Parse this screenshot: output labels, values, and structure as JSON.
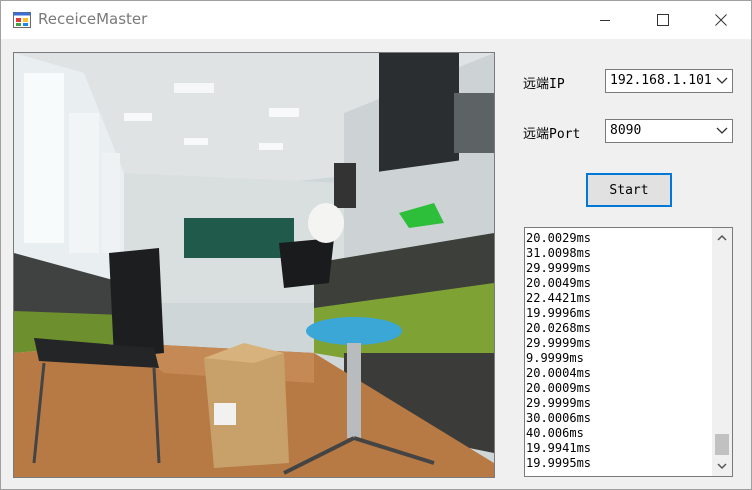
{
  "window": {
    "title": "ReceiceMaster",
    "icon": "app-window-icon",
    "controls": {
      "minimize": "minimize-icon",
      "maximize": "maximize-icon",
      "close": "close-icon"
    }
  },
  "camera_view": {
    "description_icon": "camera-frame-image"
  },
  "form": {
    "remote_ip_label": "远端IP",
    "remote_ip_value": "192.168.1.101",
    "remote_port_label": "远端Port",
    "remote_port_value": "8090",
    "start_label": "Start"
  },
  "log": {
    "items": [
      "20.0029ms",
      "31.0098ms",
      "29.9999ms",
      "20.0049ms",
      "22.4421ms",
      "19.9996ms",
      "20.0268ms",
      "29.9999ms",
      "9.9999ms",
      "20.0004ms",
      "20.0009ms",
      "29.9999ms",
      "30.0006ms",
      "40.006ms",
      "19.9941ms",
      "19.9995ms"
    ]
  },
  "colors": {
    "accent": "#0078d7",
    "window_bg": "#f0f0f0"
  }
}
